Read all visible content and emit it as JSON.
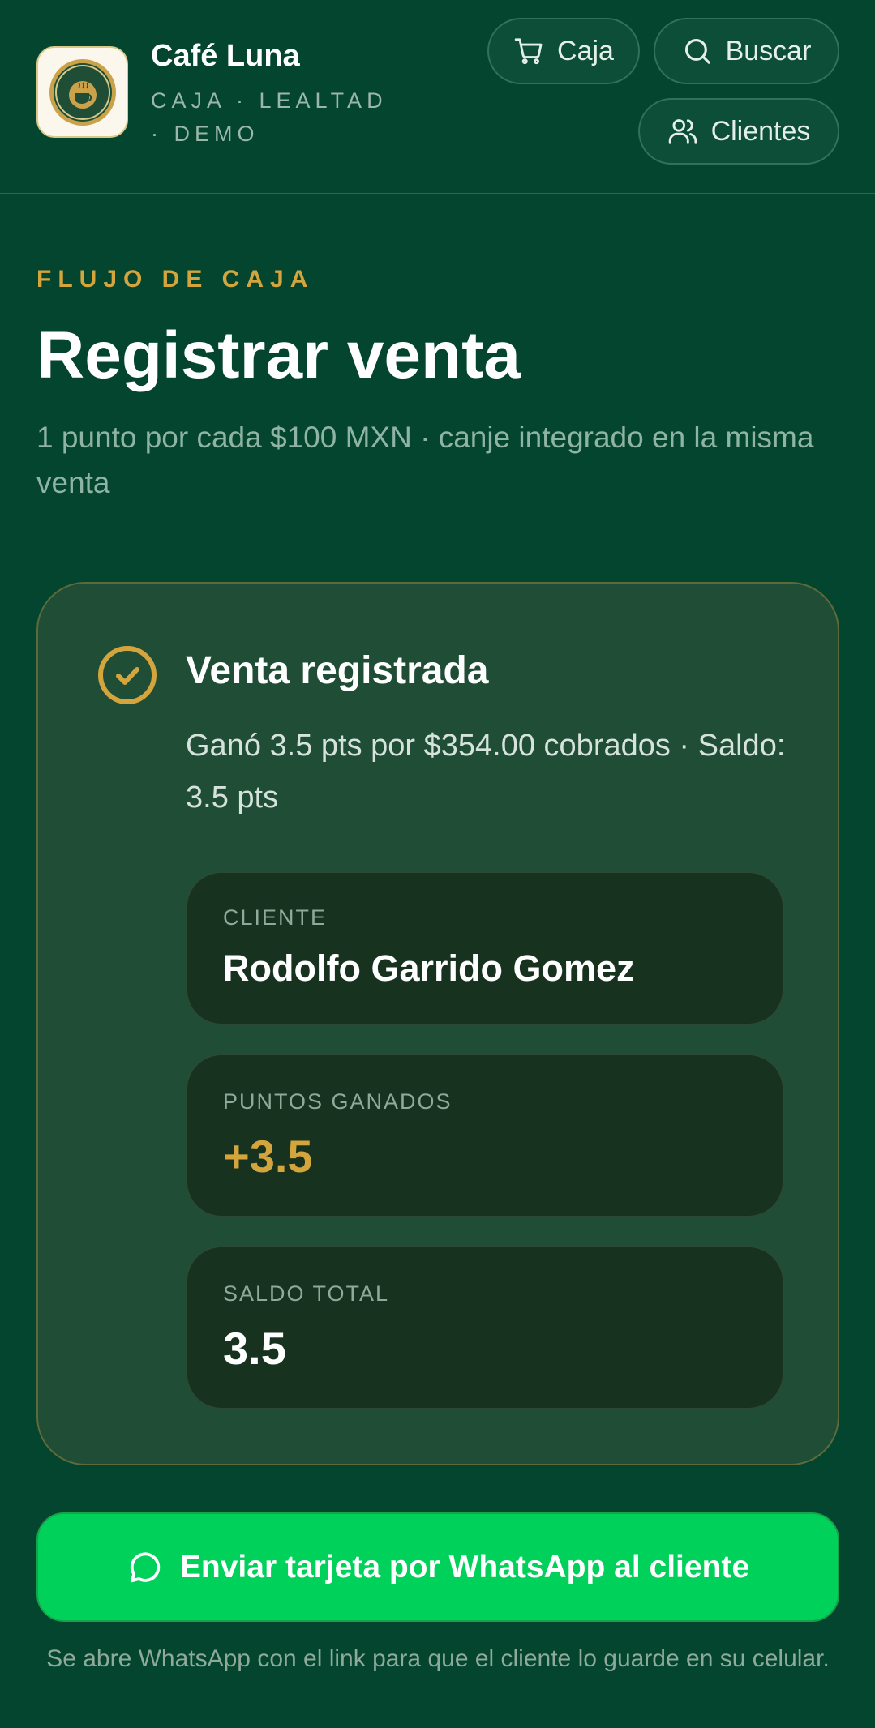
{
  "header": {
    "brand_name": "Café Luna",
    "brand_subtitle": "CAJA · LEALTAD · DEMO",
    "nav": {
      "caja": "Caja",
      "buscar": "Buscar",
      "clientes": "Clientes"
    }
  },
  "intro": {
    "eyebrow": "FLUJO DE CAJA",
    "title": "Registrar venta",
    "subtitle": "1 punto por cada $100 MXN · canje integrado en la misma venta"
  },
  "result": {
    "title": "Venta registrada",
    "description": "Ganó 3.5 pts por $354.00 cobrados · Saldo: 3.5 pts",
    "client_label": "CLIENTE",
    "client_name": "Rodolfo Garrido Gomez",
    "points_label": "PUNTOS GANADOS",
    "points_value": "+3.5",
    "balance_label": "SALDO TOTAL",
    "balance_value": "3.5"
  },
  "whatsapp": {
    "button_label": "Enviar tarjeta por WhatsApp al cliente",
    "note": "Se abre WhatsApp con el link para que el cliente lo guarde en su celular."
  },
  "colors": {
    "background": "#03452f",
    "accent_gold": "#d4a53c",
    "whatsapp_green": "#00d15a",
    "card": "#1f4d35"
  },
  "icons": [
    "cafe-luna-logo",
    "cart-icon",
    "search-icon",
    "users-icon",
    "check-circle-icon",
    "whatsapp-icon"
  ]
}
